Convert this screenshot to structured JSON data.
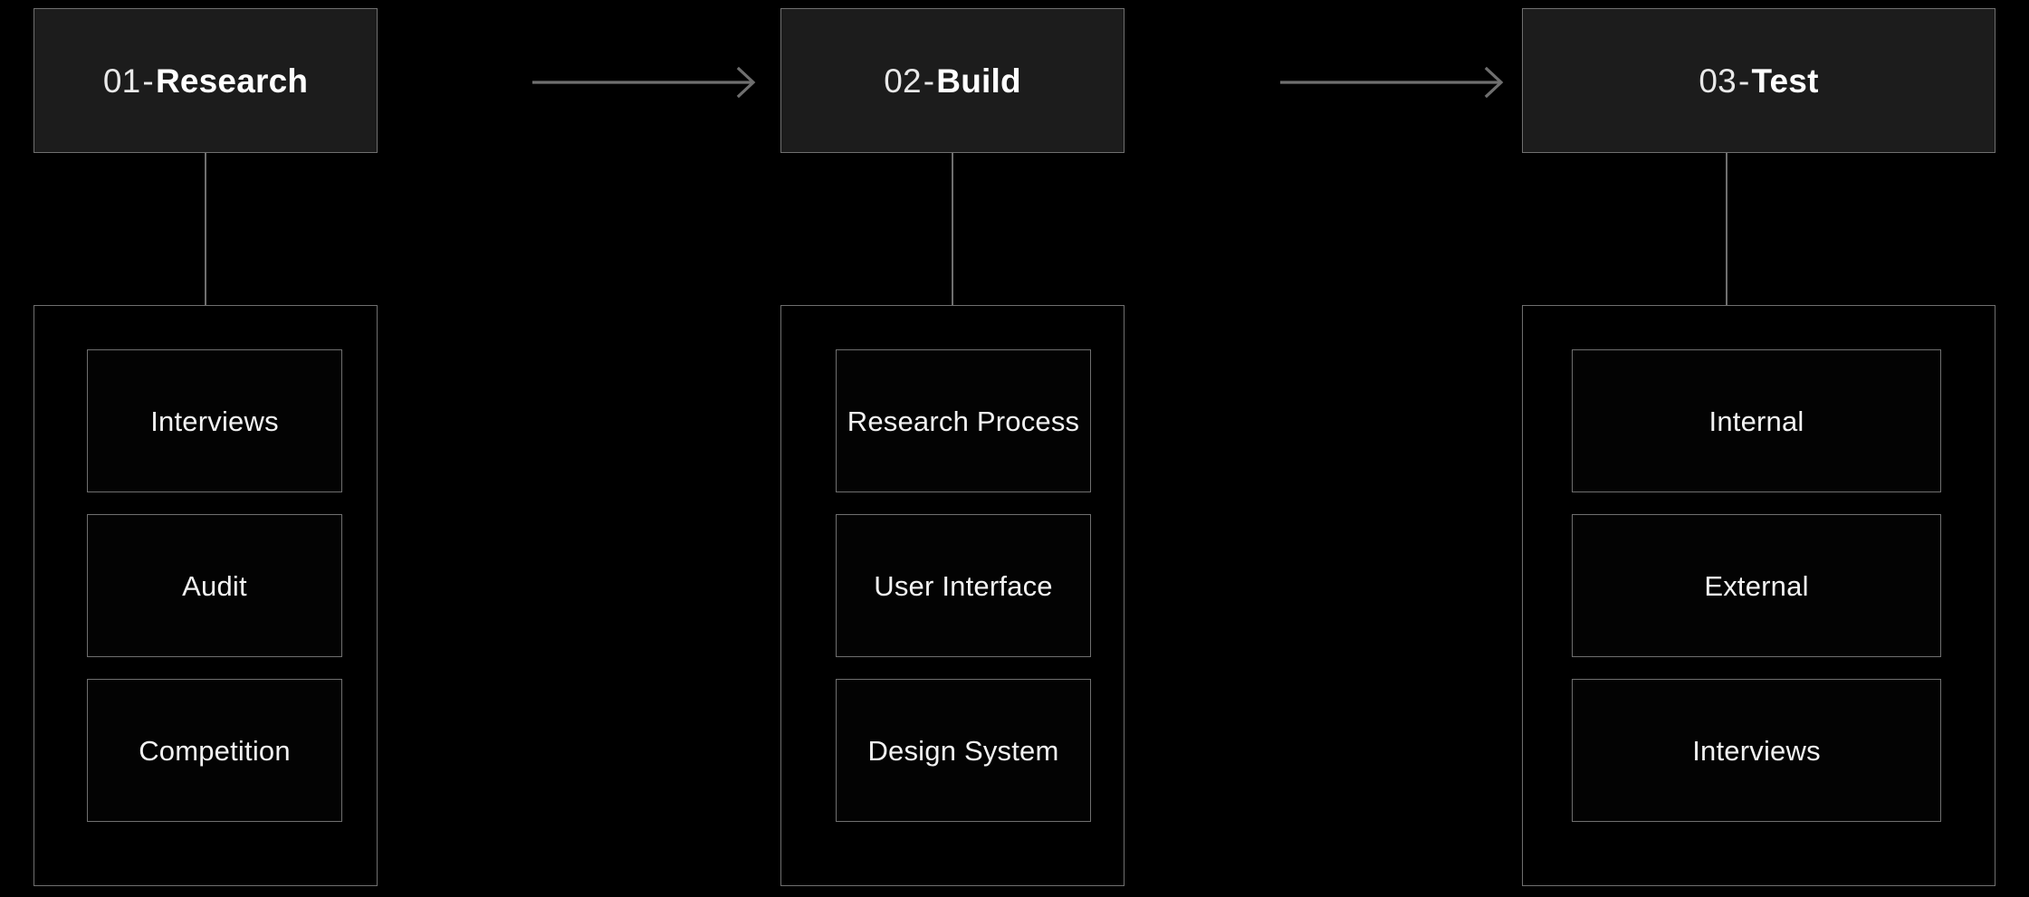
{
  "theme": {
    "background": "#000000",
    "header_fill": "#1c1c1c",
    "border": "#6f6f6f",
    "arrow": "#6f6f6f",
    "text_primary": "#ffffff",
    "text_item": "#f2f2f2"
  },
  "diagram": {
    "type": "process-flow",
    "stage_count": 3,
    "stages": [
      {
        "index": "01",
        "separator": "-",
        "name": "Research",
        "title": "01 - Research",
        "items": [
          {
            "label": "Interviews"
          },
          {
            "label": "Audit"
          },
          {
            "label": "Competition"
          }
        ]
      },
      {
        "index": "02",
        "separator": "-",
        "name": "Build",
        "title": "02 - Build",
        "items": [
          {
            "label": "Research Process"
          },
          {
            "label": "User Interface"
          },
          {
            "label": "Design System"
          }
        ]
      },
      {
        "index": "03",
        "separator": "-",
        "name": "Test",
        "title": "03 - Test",
        "items": [
          {
            "label": "Internal"
          },
          {
            "label": "External"
          },
          {
            "label": "Interviews"
          }
        ]
      }
    ],
    "connectors": [
      {
        "from": "01 - Research",
        "to": "02 - Build",
        "icon": "arrow-right-icon"
      },
      {
        "from": "02 - Build",
        "to": "03 - Test",
        "icon": "arrow-right-icon"
      }
    ]
  }
}
